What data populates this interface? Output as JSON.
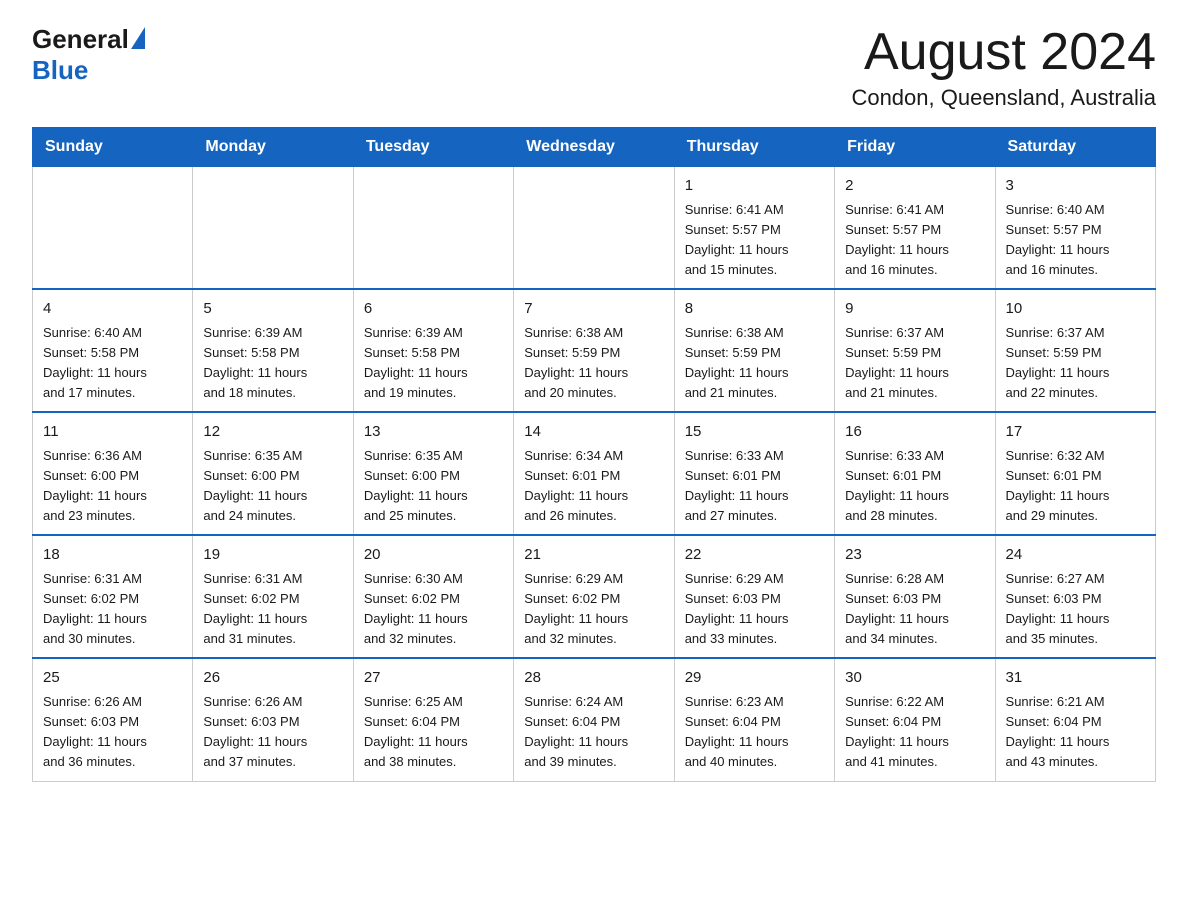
{
  "header": {
    "logo_general": "General",
    "logo_blue": "Blue",
    "title": "August 2024",
    "location": "Condon, Queensland, Australia"
  },
  "days_of_week": [
    "Sunday",
    "Monday",
    "Tuesday",
    "Wednesday",
    "Thursday",
    "Friday",
    "Saturday"
  ],
  "weeks": [
    {
      "days": [
        {
          "number": "",
          "empty": true
        },
        {
          "number": "",
          "empty": true
        },
        {
          "number": "",
          "empty": true
        },
        {
          "number": "",
          "empty": true
        },
        {
          "number": "1",
          "sunrise": "6:41 AM",
          "sunset": "5:57 PM",
          "daylight": "11 hours and 15 minutes."
        },
        {
          "number": "2",
          "sunrise": "6:41 AM",
          "sunset": "5:57 PM",
          "daylight": "11 hours and 16 minutes."
        },
        {
          "number": "3",
          "sunrise": "6:40 AM",
          "sunset": "5:57 PM",
          "daylight": "11 hours and 16 minutes."
        }
      ]
    },
    {
      "days": [
        {
          "number": "4",
          "sunrise": "6:40 AM",
          "sunset": "5:58 PM",
          "daylight": "11 hours and 17 minutes."
        },
        {
          "number": "5",
          "sunrise": "6:39 AM",
          "sunset": "5:58 PM",
          "daylight": "11 hours and 18 minutes."
        },
        {
          "number": "6",
          "sunrise": "6:39 AM",
          "sunset": "5:58 PM",
          "daylight": "11 hours and 19 minutes."
        },
        {
          "number": "7",
          "sunrise": "6:38 AM",
          "sunset": "5:59 PM",
          "daylight": "11 hours and 20 minutes."
        },
        {
          "number": "8",
          "sunrise": "6:38 AM",
          "sunset": "5:59 PM",
          "daylight": "11 hours and 21 minutes."
        },
        {
          "number": "9",
          "sunrise": "6:37 AM",
          "sunset": "5:59 PM",
          "daylight": "11 hours and 21 minutes."
        },
        {
          "number": "10",
          "sunrise": "6:37 AM",
          "sunset": "5:59 PM",
          "daylight": "11 hours and 22 minutes."
        }
      ]
    },
    {
      "days": [
        {
          "number": "11",
          "sunrise": "6:36 AM",
          "sunset": "6:00 PM",
          "daylight": "11 hours and 23 minutes."
        },
        {
          "number": "12",
          "sunrise": "6:35 AM",
          "sunset": "6:00 PM",
          "daylight": "11 hours and 24 minutes."
        },
        {
          "number": "13",
          "sunrise": "6:35 AM",
          "sunset": "6:00 PM",
          "daylight": "11 hours and 25 minutes."
        },
        {
          "number": "14",
          "sunrise": "6:34 AM",
          "sunset": "6:01 PM",
          "daylight": "11 hours and 26 minutes."
        },
        {
          "number": "15",
          "sunrise": "6:33 AM",
          "sunset": "6:01 PM",
          "daylight": "11 hours and 27 minutes."
        },
        {
          "number": "16",
          "sunrise": "6:33 AM",
          "sunset": "6:01 PM",
          "daylight": "11 hours and 28 minutes."
        },
        {
          "number": "17",
          "sunrise": "6:32 AM",
          "sunset": "6:01 PM",
          "daylight": "11 hours and 29 minutes."
        }
      ]
    },
    {
      "days": [
        {
          "number": "18",
          "sunrise": "6:31 AM",
          "sunset": "6:02 PM",
          "daylight": "11 hours and 30 minutes."
        },
        {
          "number": "19",
          "sunrise": "6:31 AM",
          "sunset": "6:02 PM",
          "daylight": "11 hours and 31 minutes."
        },
        {
          "number": "20",
          "sunrise": "6:30 AM",
          "sunset": "6:02 PM",
          "daylight": "11 hours and 32 minutes."
        },
        {
          "number": "21",
          "sunrise": "6:29 AM",
          "sunset": "6:02 PM",
          "daylight": "11 hours and 32 minutes."
        },
        {
          "number": "22",
          "sunrise": "6:29 AM",
          "sunset": "6:03 PM",
          "daylight": "11 hours and 33 minutes."
        },
        {
          "number": "23",
          "sunrise": "6:28 AM",
          "sunset": "6:03 PM",
          "daylight": "11 hours and 34 minutes."
        },
        {
          "number": "24",
          "sunrise": "6:27 AM",
          "sunset": "6:03 PM",
          "daylight": "11 hours and 35 minutes."
        }
      ]
    },
    {
      "days": [
        {
          "number": "25",
          "sunrise": "6:26 AM",
          "sunset": "6:03 PM",
          "daylight": "11 hours and 36 minutes."
        },
        {
          "number": "26",
          "sunrise": "6:26 AM",
          "sunset": "6:03 PM",
          "daylight": "11 hours and 37 minutes."
        },
        {
          "number": "27",
          "sunrise": "6:25 AM",
          "sunset": "6:04 PM",
          "daylight": "11 hours and 38 minutes."
        },
        {
          "number": "28",
          "sunrise": "6:24 AM",
          "sunset": "6:04 PM",
          "daylight": "11 hours and 39 minutes."
        },
        {
          "number": "29",
          "sunrise": "6:23 AM",
          "sunset": "6:04 PM",
          "daylight": "11 hours and 40 minutes."
        },
        {
          "number": "30",
          "sunrise": "6:22 AM",
          "sunset": "6:04 PM",
          "daylight": "11 hours and 41 minutes."
        },
        {
          "number": "31",
          "sunrise": "6:21 AM",
          "sunset": "6:04 PM",
          "daylight": "11 hours and 43 minutes."
        }
      ]
    }
  ],
  "labels": {
    "sunrise": "Sunrise:",
    "sunset": "Sunset:",
    "daylight": "Daylight:"
  }
}
